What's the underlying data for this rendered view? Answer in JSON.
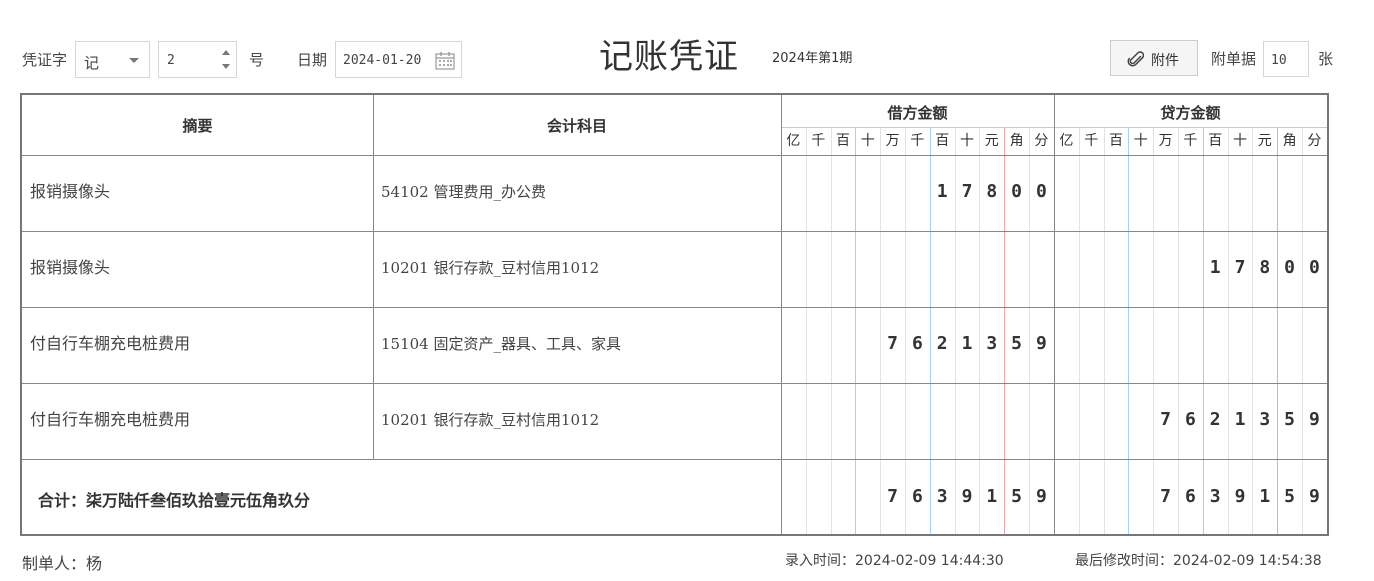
{
  "header": {
    "voucher_word_label": "凭证字",
    "voucher_word_value": "记",
    "voucher_number": "2",
    "number_suffix": "号",
    "date_label": "日期",
    "date_value": "2024-01-20",
    "title": "记账凭证",
    "period": "2024年第1期",
    "attachment_button": "附件",
    "attachment_count_label": "附单据",
    "attachment_count": "10",
    "attachment_count_unit": "张"
  },
  "table": {
    "col_summary": "摘要",
    "col_account": "会计科目",
    "col_debit": "借方金额",
    "col_credit": "贷方金额",
    "units": [
      "亿",
      "千",
      "百",
      "十",
      "万",
      "千",
      "百",
      "十",
      "元",
      "角",
      "分"
    ],
    "rows": [
      {
        "summary": "报销摄像头",
        "account": "54102 管理费用_办公费",
        "debit": "17800",
        "credit": ""
      },
      {
        "summary": "报销摄像头",
        "account": "10201 银行存款_豆村信用1012",
        "debit": "",
        "credit": "17800"
      },
      {
        "summary": "付自行车棚充电桩费用",
        "account": "15104 固定资产_器具、工具、家具",
        "debit": "7621359",
        "credit": ""
      },
      {
        "summary": "付自行车棚充电桩费用",
        "account": "10201 银行存款_豆村信用1012",
        "debit": "",
        "credit": "7621359"
      }
    ],
    "total_label": "合计：柒万陆仟叁佰玖拾壹元伍角玖分",
    "total_debit": "7639159",
    "total_credit": "7639159"
  },
  "footer": {
    "maker": "制单人：杨",
    "entry_time": "录入时间：2024-02-09 14:44:30",
    "modified_time": "最后修改时间：2024-02-09 14:54:38"
  },
  "colors": {
    "grid": "#888888",
    "minor_line": "#e2e2e2",
    "blue_separator": "#a8d0ec",
    "red_separator": "#f0a8a8"
  }
}
